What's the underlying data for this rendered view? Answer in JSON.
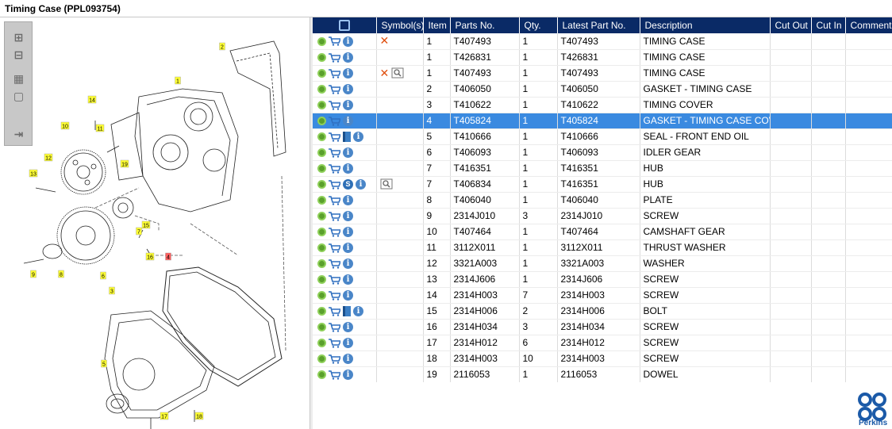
{
  "window": {
    "title": "Timing Case (PPL093754)"
  },
  "zoom_toolbar": {
    "items": [
      "zoom-in",
      "zoom-out",
      "fit-all",
      "fit-window",
      "export"
    ]
  },
  "diagram": {
    "callouts": [
      "1",
      "2",
      "3",
      "4",
      "5",
      "6",
      "7",
      "8",
      "9",
      "10",
      "11",
      "12",
      "13",
      "14",
      "15",
      "16",
      "17",
      "18",
      "19"
    ]
  },
  "table": {
    "headers": {
      "icons": "",
      "symbols": "Symbol(s)",
      "item": "Item",
      "parts_no": "Parts No.",
      "qty": "Qty.",
      "latest": "Latest Part No.",
      "description": "Description",
      "cut_out": "Cut Out",
      "cut_in": "Cut In",
      "comment": "Comment"
    },
    "rows": [
      {
        "item": "1",
        "parts_no": "T407493",
        "qty": "1",
        "latest": "T407493",
        "description": "TIMING CASE",
        "symbols": [
          "x"
        ],
        "extra": []
      },
      {
        "item": "1",
        "parts_no": "T426831",
        "qty": "1",
        "latest": "T426831",
        "description": "TIMING CASE",
        "symbols": [],
        "extra": []
      },
      {
        "item": "1",
        "parts_no": "T407493",
        "qty": "1",
        "latest": "T407493",
        "description": "TIMING CASE",
        "symbols": [
          "x",
          "magic"
        ],
        "extra": []
      },
      {
        "item": "2",
        "parts_no": "T406050",
        "qty": "1",
        "latest": "T406050",
        "description": "GASKET - TIMING CASE",
        "symbols": [],
        "extra": []
      },
      {
        "item": "3",
        "parts_no": "T410622",
        "qty": "1",
        "latest": "T410622",
        "description": "TIMING COVER",
        "symbols": [],
        "extra": []
      },
      {
        "item": "4",
        "parts_no": "T405824",
        "qty": "1",
        "latest": "T405824",
        "description": "GASKET - TIMING CASE COVER",
        "symbols": [],
        "extra": [],
        "selected": true
      },
      {
        "item": "5",
        "parts_no": "T410666",
        "qty": "1",
        "latest": "T410666",
        "description": "SEAL - FRONT END OIL",
        "symbols": [],
        "extra": [
          "book"
        ]
      },
      {
        "item": "6",
        "parts_no": "T406093",
        "qty": "1",
        "latest": "T406093",
        "description": "IDLER GEAR",
        "symbols": [],
        "extra": []
      },
      {
        "item": "7",
        "parts_no": "T416351",
        "qty": "1",
        "latest": "T416351",
        "description": "HUB",
        "symbols": [],
        "extra": []
      },
      {
        "item": "7",
        "parts_no": "T406834",
        "qty": "1",
        "latest": "T416351",
        "description": "HUB",
        "symbols": [
          "magic"
        ],
        "extra": [
          "service"
        ]
      },
      {
        "item": "8",
        "parts_no": "T406040",
        "qty": "1",
        "latest": "T406040",
        "description": "PLATE",
        "symbols": [],
        "extra": []
      },
      {
        "item": "9",
        "parts_no": "2314J010",
        "qty": "3",
        "latest": "2314J010",
        "description": "SCREW",
        "symbols": [],
        "extra": []
      },
      {
        "item": "10",
        "parts_no": "T407464",
        "qty": "1",
        "latest": "T407464",
        "description": "CAMSHAFT GEAR",
        "symbols": [],
        "extra": []
      },
      {
        "item": "11",
        "parts_no": "3112X011",
        "qty": "1",
        "latest": "3112X011",
        "description": "THRUST WASHER",
        "symbols": [],
        "extra": []
      },
      {
        "item": "12",
        "parts_no": "3321A003",
        "qty": "1",
        "latest": "3321A003",
        "description": "WASHER",
        "symbols": [],
        "extra": []
      },
      {
        "item": "13",
        "parts_no": "2314J606",
        "qty": "1",
        "latest": "2314J606",
        "description": "SCREW",
        "symbols": [],
        "extra": []
      },
      {
        "item": "14",
        "parts_no": "2314H003",
        "qty": "7",
        "latest": "2314H003",
        "description": "SCREW",
        "symbols": [],
        "extra": []
      },
      {
        "item": "15",
        "parts_no": "2314H006",
        "qty": "2",
        "latest": "2314H006",
        "description": "BOLT",
        "symbols": [],
        "extra": [
          "book"
        ]
      },
      {
        "item": "16",
        "parts_no": "2314H034",
        "qty": "3",
        "latest": "2314H034",
        "description": "SCREW",
        "symbols": [],
        "extra": []
      },
      {
        "item": "17",
        "parts_no": "2314H012",
        "qty": "6",
        "latest": "2314H012",
        "description": "SCREW",
        "symbols": [],
        "extra": []
      },
      {
        "item": "18",
        "parts_no": "2314H003",
        "qty": "10",
        "latest": "2314H003",
        "description": "SCREW",
        "symbols": [],
        "extra": []
      },
      {
        "item": "19",
        "parts_no": "2116053",
        "qty": "1",
        "latest": "2116053",
        "description": "DOWEL",
        "symbols": [],
        "extra": []
      }
    ]
  },
  "logo": {
    "brand": "Perkins"
  },
  "colors": {
    "header_bg": "#0a2a66",
    "selected_row": "#3a8ae0",
    "callout_yellow": "#ffff33",
    "callout_red": "#ff6060"
  }
}
